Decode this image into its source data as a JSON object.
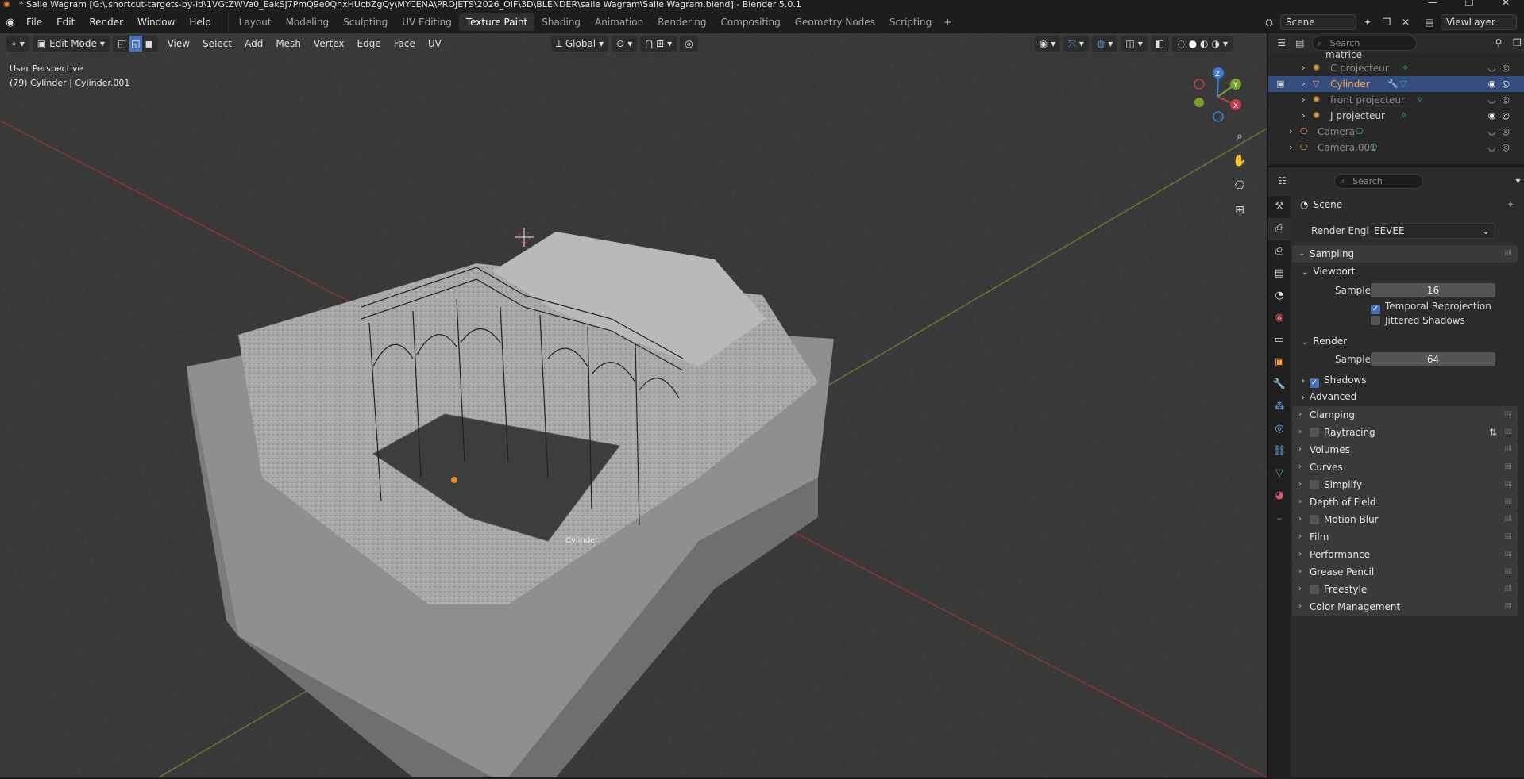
{
  "title": "* Salle Wagram [G:\\.shortcut-targets-by-id\\1VGtZWVa0_EakSj7PmQ9e0QnxHUcbZgQy\\MYCENA\\PROJETS\\2026_OIF\\3D\\BLENDER\\salle Wagram\\Salle Wagram.blend] - Blender 5.0.1",
  "menu": [
    "File",
    "Edit",
    "Render",
    "Window",
    "Help"
  ],
  "workspaces": [
    {
      "label": "Layout",
      "active": false
    },
    {
      "label": "Modeling",
      "active": false
    },
    {
      "label": "Sculpting",
      "active": false
    },
    {
      "label": "UV Editing",
      "active": false
    },
    {
      "label": "Texture Paint",
      "active": true
    },
    {
      "label": "Shading",
      "active": false
    },
    {
      "label": "Animation",
      "active": false
    },
    {
      "label": "Rendering",
      "active": false
    },
    {
      "label": "Compositing",
      "active": false
    },
    {
      "label": "Geometry Nodes",
      "active": false
    },
    {
      "label": "Scripting",
      "active": false
    }
  ],
  "scene_name": "Scene",
  "view_layer": "ViewLayer",
  "viewport": {
    "mode": "Edit Mode",
    "menus": [
      "View",
      "Select",
      "Add",
      "Mesh",
      "Vertex",
      "Edge",
      "Face",
      "UV"
    ],
    "transform_orientation": "Global",
    "perspective_label": "User Perspective",
    "object_info": "(79) Cylinder | Cylinder.001",
    "object_label": "Cylinder",
    "gizmo": {
      "x": "X",
      "y": "Y",
      "z": "Z"
    }
  },
  "outliner": {
    "search_placeholder": "Search",
    "parent": "matrice",
    "items": [
      {
        "label": "C projecteur",
        "selected": false
      },
      {
        "label": "Cylinder",
        "selected": true
      },
      {
        "label": "front projecteur",
        "selected": false
      },
      {
        "label": "J projecteur",
        "selected": false
      },
      {
        "label": "Camera",
        "selected": false
      },
      {
        "label": "Camera.001",
        "selected": false
      }
    ]
  },
  "properties": {
    "search_placeholder": "Search",
    "context": "Scene",
    "render_engine_label": "Render Engine",
    "render_engine": "EEVEE",
    "sampling": {
      "label": "Sampling",
      "viewport_label": "Viewport",
      "viewport_samples_label": "Samples",
      "viewport_samples": "16",
      "temporal_reprojection": "Temporal Reprojection",
      "jittered_shadows": "Jittered Shadows",
      "render_label": "Render",
      "render_samples_label": "Samples",
      "render_samples": "64",
      "shadows": "Shadows",
      "advanced": "Advanced"
    },
    "panels": [
      "Clamping",
      "Raytracing",
      "Volumes",
      "Curves",
      "Simplify",
      "Depth of Field",
      "Motion Blur",
      "Film",
      "Performance",
      "Grease Pencil",
      "Freestyle",
      "Color Management"
    ]
  }
}
